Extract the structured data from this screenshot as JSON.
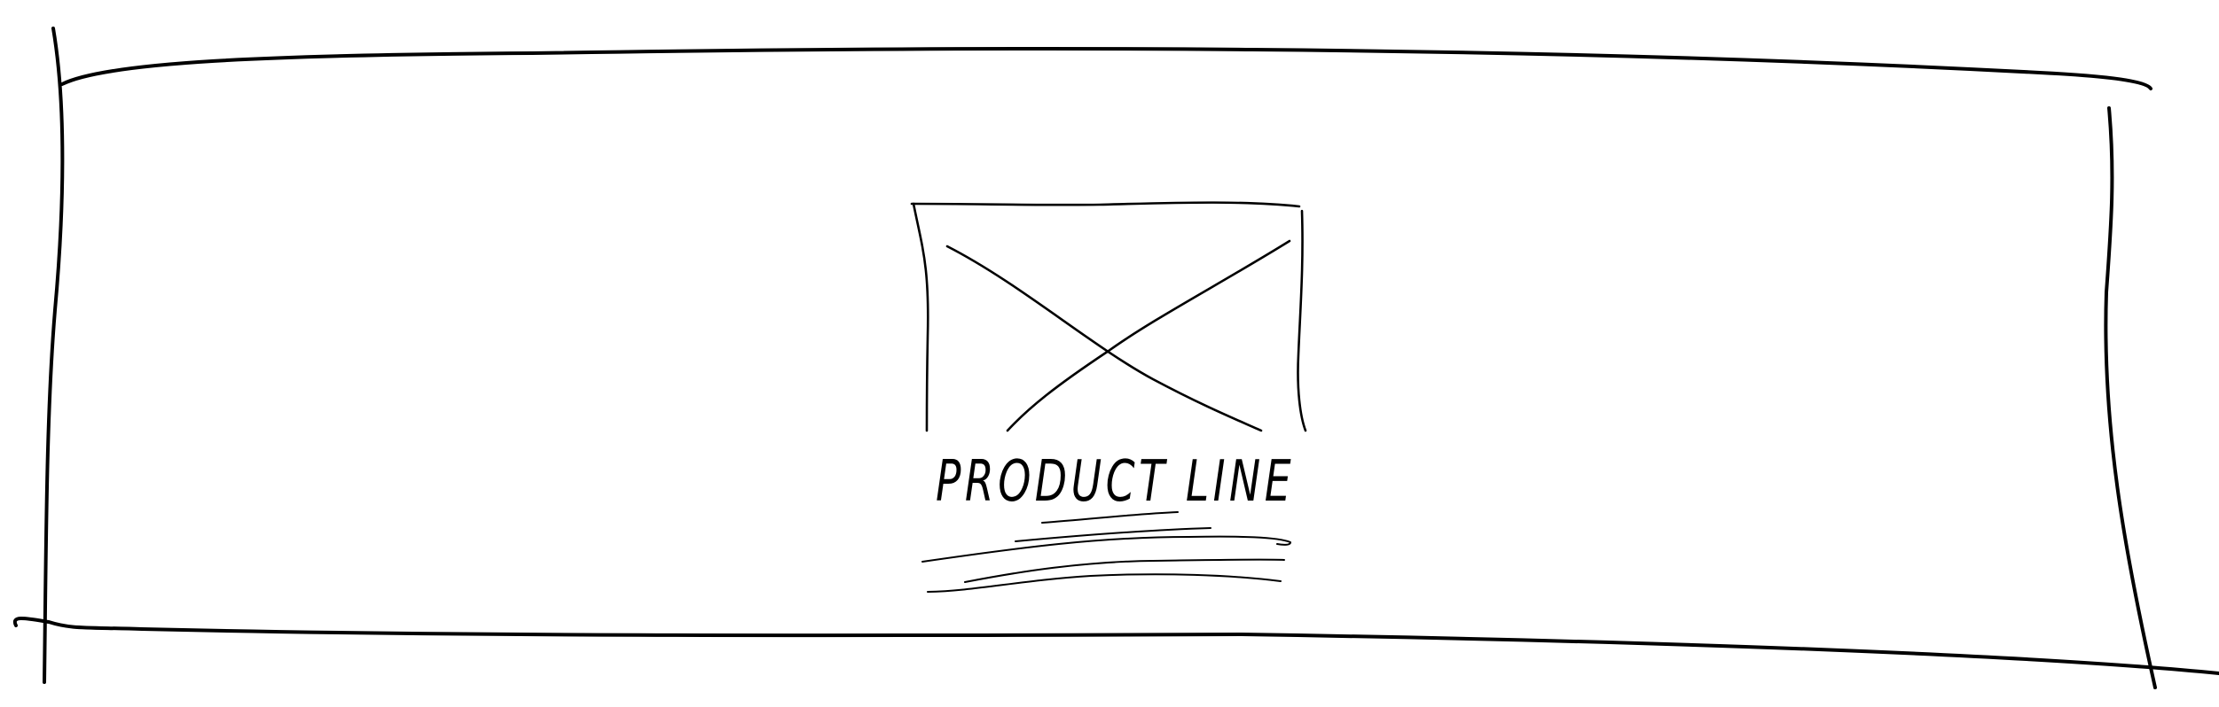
{
  "wireframe": {
    "title": "PRODUCT LINE",
    "image_placeholder_icon": "image-placeholder-icon",
    "stroke_color": "#000000",
    "background_color": "#ffffff"
  }
}
